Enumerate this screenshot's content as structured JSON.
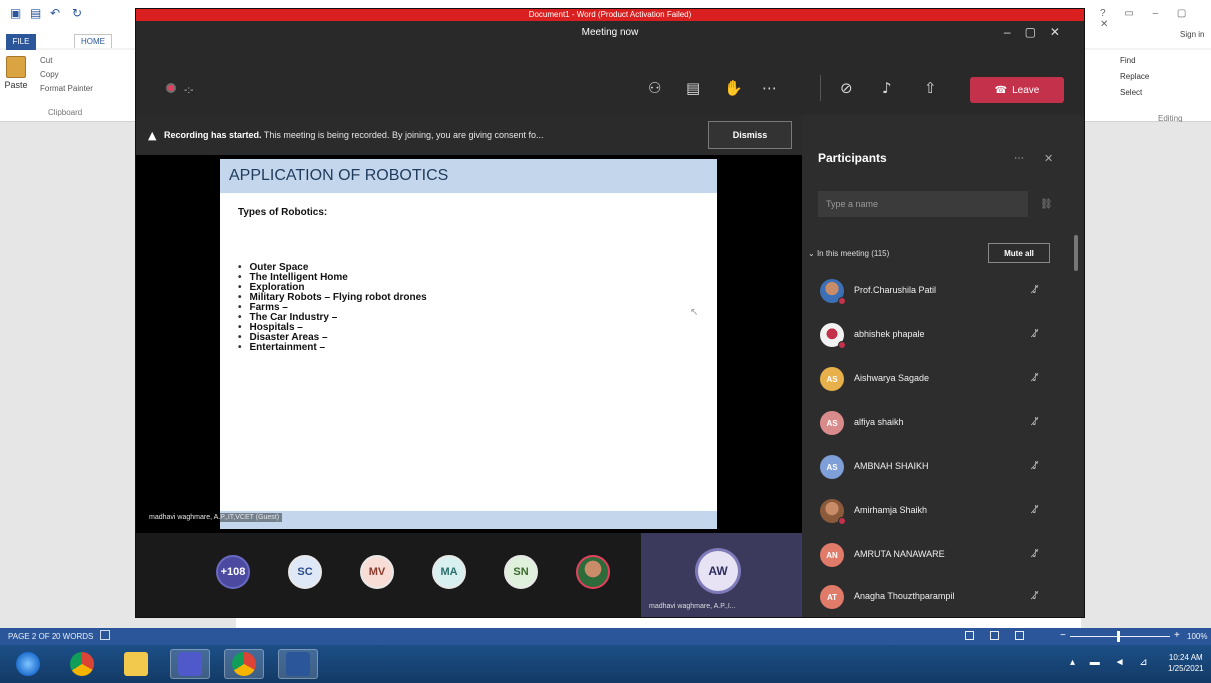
{
  "word": {
    "title": "Document1 - Word (Product Activation Failed)",
    "file_tab": "FILE",
    "home_tab": "HOME",
    "clipboard_items": [
      "Cut",
      "Copy",
      "Format Painter"
    ],
    "paste": "Paste",
    "clipboard_label": "Clipboard",
    "editing_items": [
      "Find",
      "Replace",
      "Select"
    ],
    "editing_label": "Editing",
    "signin": "Sign in",
    "status": {
      "page": "PAGE 2 OF 2",
      "words": "0 WORDS",
      "zoom": "100%"
    }
  },
  "taskbar": {
    "clock_time": "10:24 AM",
    "clock_date": "1/25/2021"
  },
  "teams": {
    "meeting_title": "Meeting now",
    "rec_indicator": "-:-",
    "leave_label": "Leave",
    "banner": {
      "bold": "Recording has started.",
      "text": "This meeting is being recorded. By joining, you are giving consent fo...",
      "dismiss": "Dismiss"
    },
    "slide": {
      "title": "APPLICATION OF ROBOTICS",
      "subtitle": "Types of Robotics:",
      "items": [
        "Outer Space",
        "The Intelligent Home",
        "Exploration",
        "Military Robots – Flying robot drones",
        "Farms –",
        "The Car Industry –",
        "Hospitals –",
        "Disaster Areas –",
        "Entertainment –"
      ]
    },
    "presenter_caption": "madhavi waghmare, A.P.,IT,VCET (Guest)",
    "strip": {
      "overflow": "+108",
      "avatars": [
        "SC",
        "MV",
        "MA",
        "SN"
      ],
      "tile_initials": "AW",
      "tile_name": "madhavi waghmare, A.P.,I..."
    },
    "participants": {
      "title": "Participants",
      "search_placeholder": "Type a name",
      "in_meeting": "In this meeting (115)",
      "mute_all": "Mute all",
      "people": [
        {
          "initials": "",
          "name": "Prof.Charushila Patil"
        },
        {
          "initials": "",
          "name": "abhishek phapale"
        },
        {
          "initials": "AS",
          "name": "Aishwarya Sagade"
        },
        {
          "initials": "AS",
          "name": "alfiya shaikh"
        },
        {
          "initials": "AS",
          "name": "AMBNAH SHAIKH"
        },
        {
          "initials": "",
          "name": "Amirhamja Shaikh"
        },
        {
          "initials": "AN",
          "name": "AMRUTA NANAWARE"
        },
        {
          "initials": "AT",
          "name": "Anagha Thouzthparampil"
        }
      ]
    }
  },
  "colors": {
    "teams_dark": "#292929",
    "leave_red": "#c4314b",
    "word_blue": "#2b579a",
    "title_red": "#d91f1f"
  }
}
